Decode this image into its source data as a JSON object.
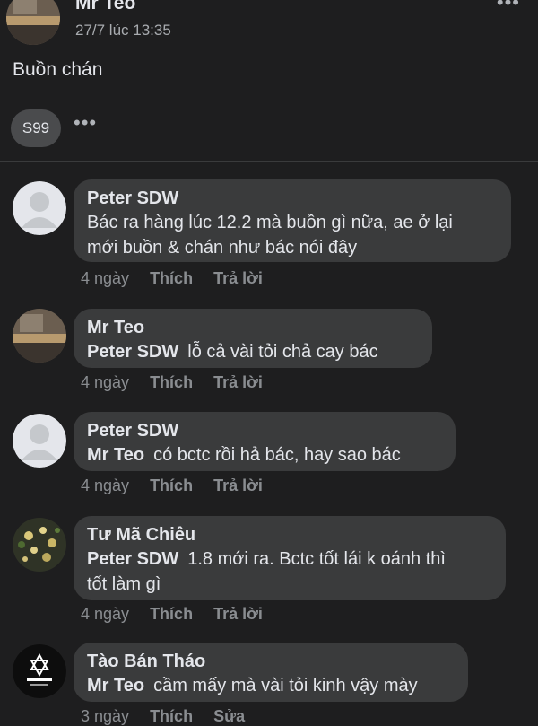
{
  "post": {
    "author": "Mr Teo",
    "time": "27/7 lúc 13:35",
    "text": "Buồn chán",
    "reaction_chip": "S99",
    "more_icon": "ellipsis-icon"
  },
  "comments": [
    {
      "name": "Peter SDW",
      "mention": "",
      "text_line1": "Bác ra hàng lúc 12.2 mà buồn gì  nữa, ae ở lại",
      "text_line2": "mới buồn & chán như bác nói đây",
      "time": "4 ngày",
      "like": "Thích",
      "reply": "Trả lời",
      "avatar": "default-avatar"
    },
    {
      "name": "Mr Teo",
      "mention": "Peter SDW",
      "text_line1": "lỗ cả vài tỏi chả cay bác",
      "time": "4 ngày",
      "like": "Thích",
      "reply": "Trả lời",
      "avatar": "room-photo-avatar"
    },
    {
      "name": "Peter SDW",
      "mention": "Mr Teo",
      "text_line1": "có bctc rồi hả bác, hay sao bác",
      "time": "4 ngày",
      "like": "Thích",
      "reply": "Trả lời",
      "avatar": "default-avatar"
    },
    {
      "name": "Tư Mã Chiêu",
      "mention": "Peter SDW",
      "text_line1": "1.8 mới ra. Bctc tốt lái k oánh thì",
      "text_line2": "tốt làm gì",
      "time": "4 ngày",
      "like": "Thích",
      "reply": "Trả lời",
      "avatar": "flowers-avatar"
    },
    {
      "name": "Tào Bán Tháo",
      "mention": "Mr Teo",
      "text_line1": "cầm mấy mà vài tỏi kinh vậy mày",
      "time": "3 ngày",
      "like": "Thích",
      "reply": "Sửa",
      "avatar": "star-logo-avatar"
    }
  ]
}
